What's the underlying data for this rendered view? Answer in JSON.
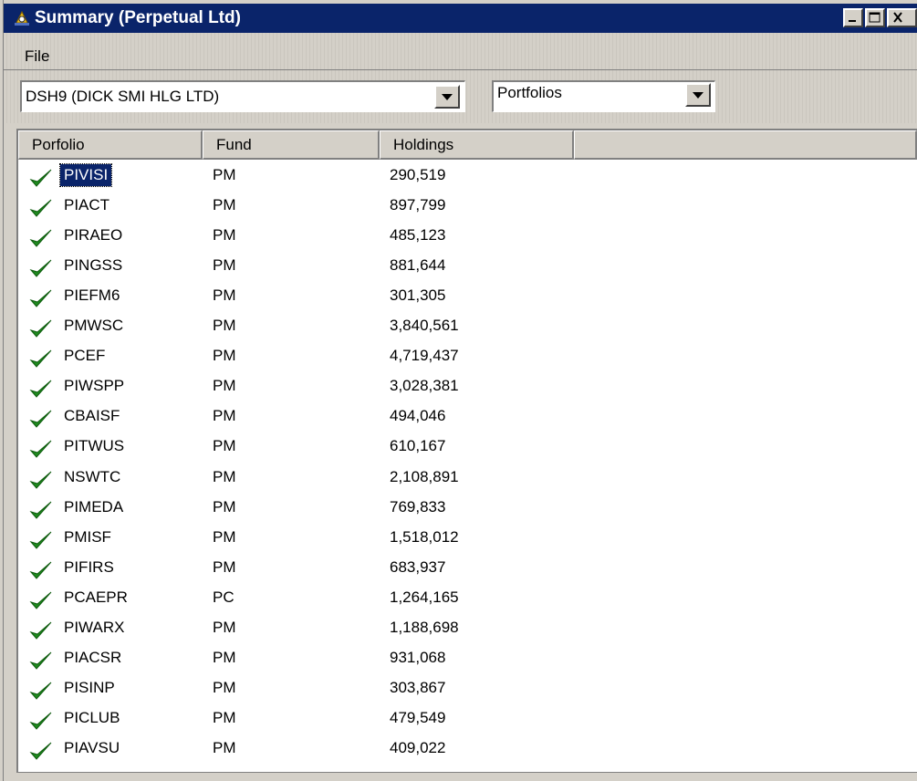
{
  "window": {
    "title": "Summary (Perpetual Ltd)",
    "title_bg": "#0a246a"
  },
  "menu": {
    "file_label": "File"
  },
  "toolbar": {
    "entity_value": "DSH9 (DICK SMI HLG LTD)",
    "view_value": "Portfolios"
  },
  "table": {
    "headers": [
      "Porfolio",
      "Fund",
      "Holdings"
    ],
    "rows": [
      {
        "portfolio": "PIVISI",
        "fund": "PM",
        "holdings": "290,519",
        "checked": true,
        "selected": true
      },
      {
        "portfolio": "PIACT",
        "fund": "PM",
        "holdings": "897,799",
        "checked": true
      },
      {
        "portfolio": "PIRAEO",
        "fund": "PM",
        "holdings": "485,123",
        "checked": true
      },
      {
        "portfolio": "PINGSS",
        "fund": "PM",
        "holdings": "881,644",
        "checked": true
      },
      {
        "portfolio": "PIEFM6",
        "fund": "PM",
        "holdings": "301,305",
        "checked": true
      },
      {
        "portfolio": "PMWSC",
        "fund": "PM",
        "holdings": "3,840,561",
        "checked": true
      },
      {
        "portfolio": "PCEF",
        "fund": "PM",
        "holdings": "4,719,437",
        "checked": true
      },
      {
        "portfolio": "PIWSPP",
        "fund": "PM",
        "holdings": "3,028,381",
        "checked": true
      },
      {
        "portfolio": "CBAISF",
        "fund": "PM",
        "holdings": "494,046",
        "checked": true
      },
      {
        "portfolio": "PITWUS",
        "fund": "PM",
        "holdings": "610,167",
        "checked": true
      },
      {
        "portfolio": "NSWTC",
        "fund": "PM",
        "holdings": "2,108,891",
        "checked": true
      },
      {
        "portfolio": "PIMEDA",
        "fund": "PM",
        "holdings": "769,833",
        "checked": true
      },
      {
        "portfolio": "PMISF",
        "fund": "PM",
        "holdings": "1,518,012",
        "checked": true
      },
      {
        "portfolio": "PIFIRS",
        "fund": "PM",
        "holdings": "683,937",
        "checked": true
      },
      {
        "portfolio": "PCAEPR",
        "fund": "PC",
        "holdings": "1,264,165",
        "checked": true
      },
      {
        "portfolio": "PIWARX",
        "fund": "PM",
        "holdings": "1,188,698",
        "checked": true
      },
      {
        "portfolio": "PIACSR",
        "fund": "PM",
        "holdings": "931,068",
        "checked": true
      },
      {
        "portfolio": "PISINP",
        "fund": "PM",
        "holdings": "303,867",
        "checked": true
      },
      {
        "portfolio": "PICLUB",
        "fund": "PM",
        "holdings": "479,549",
        "checked": true
      },
      {
        "portfolio": "PIAVSU",
        "fund": "PM",
        "holdings": "409,022",
        "checked": true
      }
    ],
    "check_color": "#1f8a1f",
    "selection_color": "#0a246a"
  }
}
